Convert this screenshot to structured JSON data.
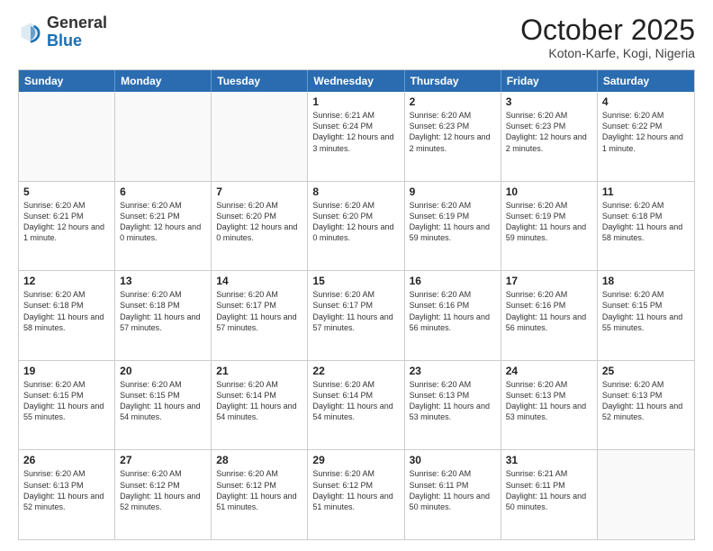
{
  "header": {
    "logo": {
      "line1": "General",
      "line2": "Blue"
    },
    "month": "October 2025",
    "location": "Koton-Karfe, Kogi, Nigeria"
  },
  "weekdays": [
    "Sunday",
    "Monday",
    "Tuesday",
    "Wednesday",
    "Thursday",
    "Friday",
    "Saturday"
  ],
  "weeks": [
    [
      {
        "day": "",
        "text": ""
      },
      {
        "day": "",
        "text": ""
      },
      {
        "day": "",
        "text": ""
      },
      {
        "day": "1",
        "text": "Sunrise: 6:21 AM\nSunset: 6:24 PM\nDaylight: 12 hours and 3 minutes."
      },
      {
        "day": "2",
        "text": "Sunrise: 6:20 AM\nSunset: 6:23 PM\nDaylight: 12 hours and 2 minutes."
      },
      {
        "day": "3",
        "text": "Sunrise: 6:20 AM\nSunset: 6:23 PM\nDaylight: 12 hours and 2 minutes."
      },
      {
        "day": "4",
        "text": "Sunrise: 6:20 AM\nSunset: 6:22 PM\nDaylight: 12 hours and 1 minute."
      }
    ],
    [
      {
        "day": "5",
        "text": "Sunrise: 6:20 AM\nSunset: 6:21 PM\nDaylight: 12 hours and 1 minute."
      },
      {
        "day": "6",
        "text": "Sunrise: 6:20 AM\nSunset: 6:21 PM\nDaylight: 12 hours and 0 minutes."
      },
      {
        "day": "7",
        "text": "Sunrise: 6:20 AM\nSunset: 6:20 PM\nDaylight: 12 hours and 0 minutes."
      },
      {
        "day": "8",
        "text": "Sunrise: 6:20 AM\nSunset: 6:20 PM\nDaylight: 12 hours and 0 minutes."
      },
      {
        "day": "9",
        "text": "Sunrise: 6:20 AM\nSunset: 6:19 PM\nDaylight: 11 hours and 59 minutes."
      },
      {
        "day": "10",
        "text": "Sunrise: 6:20 AM\nSunset: 6:19 PM\nDaylight: 11 hours and 59 minutes."
      },
      {
        "day": "11",
        "text": "Sunrise: 6:20 AM\nSunset: 6:18 PM\nDaylight: 11 hours and 58 minutes."
      }
    ],
    [
      {
        "day": "12",
        "text": "Sunrise: 6:20 AM\nSunset: 6:18 PM\nDaylight: 11 hours and 58 minutes."
      },
      {
        "day": "13",
        "text": "Sunrise: 6:20 AM\nSunset: 6:18 PM\nDaylight: 11 hours and 57 minutes."
      },
      {
        "day": "14",
        "text": "Sunrise: 6:20 AM\nSunset: 6:17 PM\nDaylight: 11 hours and 57 minutes."
      },
      {
        "day": "15",
        "text": "Sunrise: 6:20 AM\nSunset: 6:17 PM\nDaylight: 11 hours and 57 minutes."
      },
      {
        "day": "16",
        "text": "Sunrise: 6:20 AM\nSunset: 6:16 PM\nDaylight: 11 hours and 56 minutes."
      },
      {
        "day": "17",
        "text": "Sunrise: 6:20 AM\nSunset: 6:16 PM\nDaylight: 11 hours and 56 minutes."
      },
      {
        "day": "18",
        "text": "Sunrise: 6:20 AM\nSunset: 6:15 PM\nDaylight: 11 hours and 55 minutes."
      }
    ],
    [
      {
        "day": "19",
        "text": "Sunrise: 6:20 AM\nSunset: 6:15 PM\nDaylight: 11 hours and 55 minutes."
      },
      {
        "day": "20",
        "text": "Sunrise: 6:20 AM\nSunset: 6:15 PM\nDaylight: 11 hours and 54 minutes."
      },
      {
        "day": "21",
        "text": "Sunrise: 6:20 AM\nSunset: 6:14 PM\nDaylight: 11 hours and 54 minutes."
      },
      {
        "day": "22",
        "text": "Sunrise: 6:20 AM\nSunset: 6:14 PM\nDaylight: 11 hours and 54 minutes."
      },
      {
        "day": "23",
        "text": "Sunrise: 6:20 AM\nSunset: 6:13 PM\nDaylight: 11 hours and 53 minutes."
      },
      {
        "day": "24",
        "text": "Sunrise: 6:20 AM\nSunset: 6:13 PM\nDaylight: 11 hours and 53 minutes."
      },
      {
        "day": "25",
        "text": "Sunrise: 6:20 AM\nSunset: 6:13 PM\nDaylight: 11 hours and 52 minutes."
      }
    ],
    [
      {
        "day": "26",
        "text": "Sunrise: 6:20 AM\nSunset: 6:13 PM\nDaylight: 11 hours and 52 minutes."
      },
      {
        "day": "27",
        "text": "Sunrise: 6:20 AM\nSunset: 6:12 PM\nDaylight: 11 hours and 52 minutes."
      },
      {
        "day": "28",
        "text": "Sunrise: 6:20 AM\nSunset: 6:12 PM\nDaylight: 11 hours and 51 minutes."
      },
      {
        "day": "29",
        "text": "Sunrise: 6:20 AM\nSunset: 6:12 PM\nDaylight: 11 hours and 51 minutes."
      },
      {
        "day": "30",
        "text": "Sunrise: 6:20 AM\nSunset: 6:11 PM\nDaylight: 11 hours and 50 minutes."
      },
      {
        "day": "31",
        "text": "Sunrise: 6:21 AM\nSunset: 6:11 PM\nDaylight: 11 hours and 50 minutes."
      },
      {
        "day": "",
        "text": ""
      }
    ]
  ]
}
